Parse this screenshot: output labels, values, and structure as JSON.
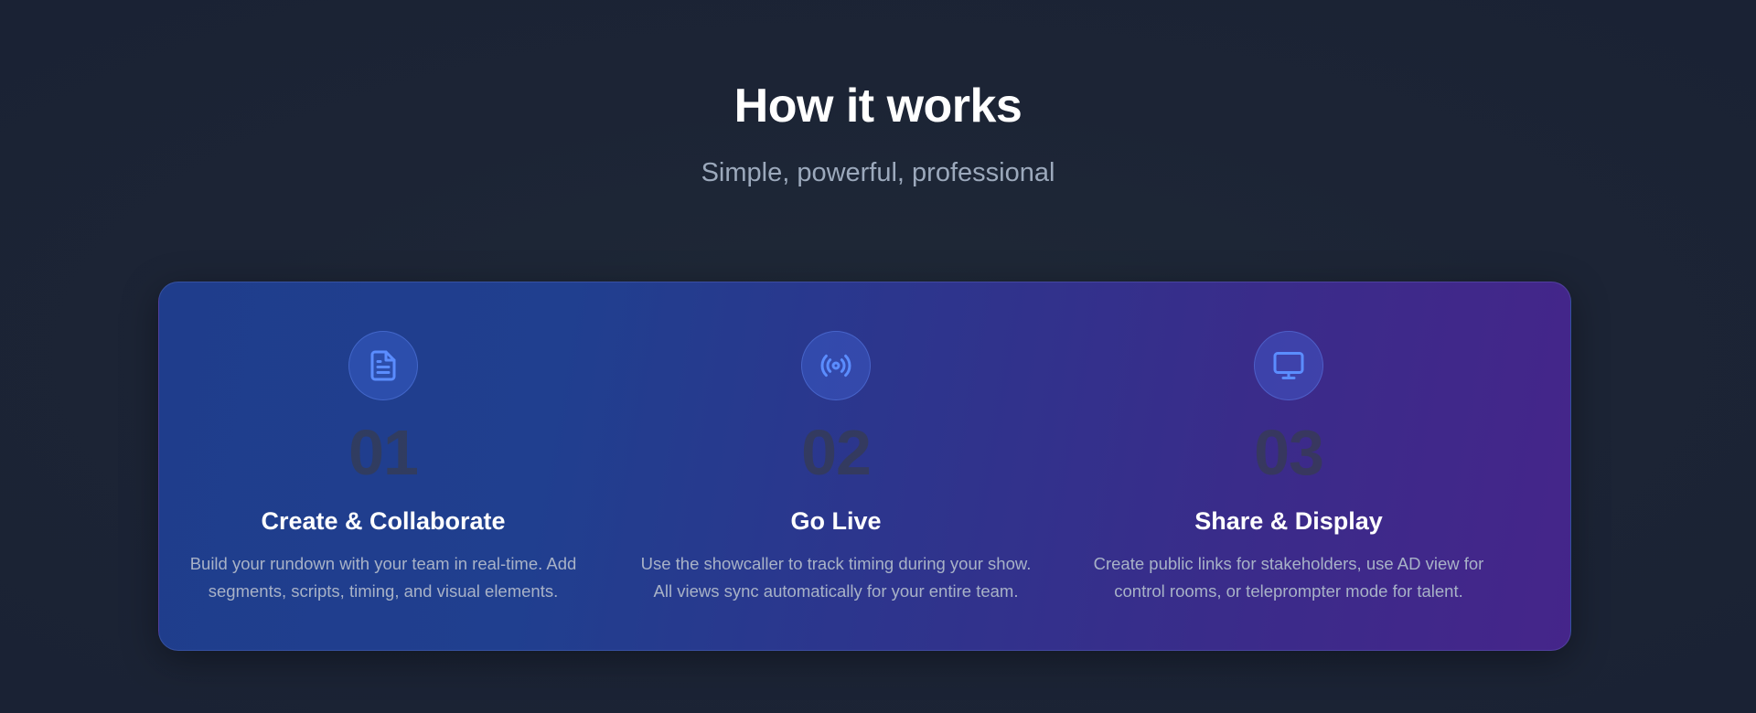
{
  "header": {
    "title": "How it works",
    "subtitle": "Simple, powerful, professional"
  },
  "steps": [
    {
      "icon": "document-icon",
      "number": "01",
      "title": "Create & Collaborate",
      "description_line1": "Build your rundown with your team in real-time. Add",
      "description_line2": "segments, scripts, timing, and visual elements."
    },
    {
      "icon": "broadcast-icon",
      "number": "02",
      "title": "Go Live",
      "description_line1": "Use the showcaller to track timing during your show.",
      "description_line2": "All views sync automatically for your entire team."
    },
    {
      "icon": "monitor-icon",
      "number": "03",
      "title": "Share & Display",
      "description_line1": "Create public links for stakeholders, use AD view for",
      "description_line2": "control rooms, or teleprompter mode for talent."
    }
  ],
  "colors": {
    "background": "#1c2435",
    "panel_start": "#1f3d8c",
    "panel_end": "#45258a",
    "icon_accent": "#5b8dff",
    "title_text": "#ffffff",
    "muted_text": "#a8b2c7"
  }
}
